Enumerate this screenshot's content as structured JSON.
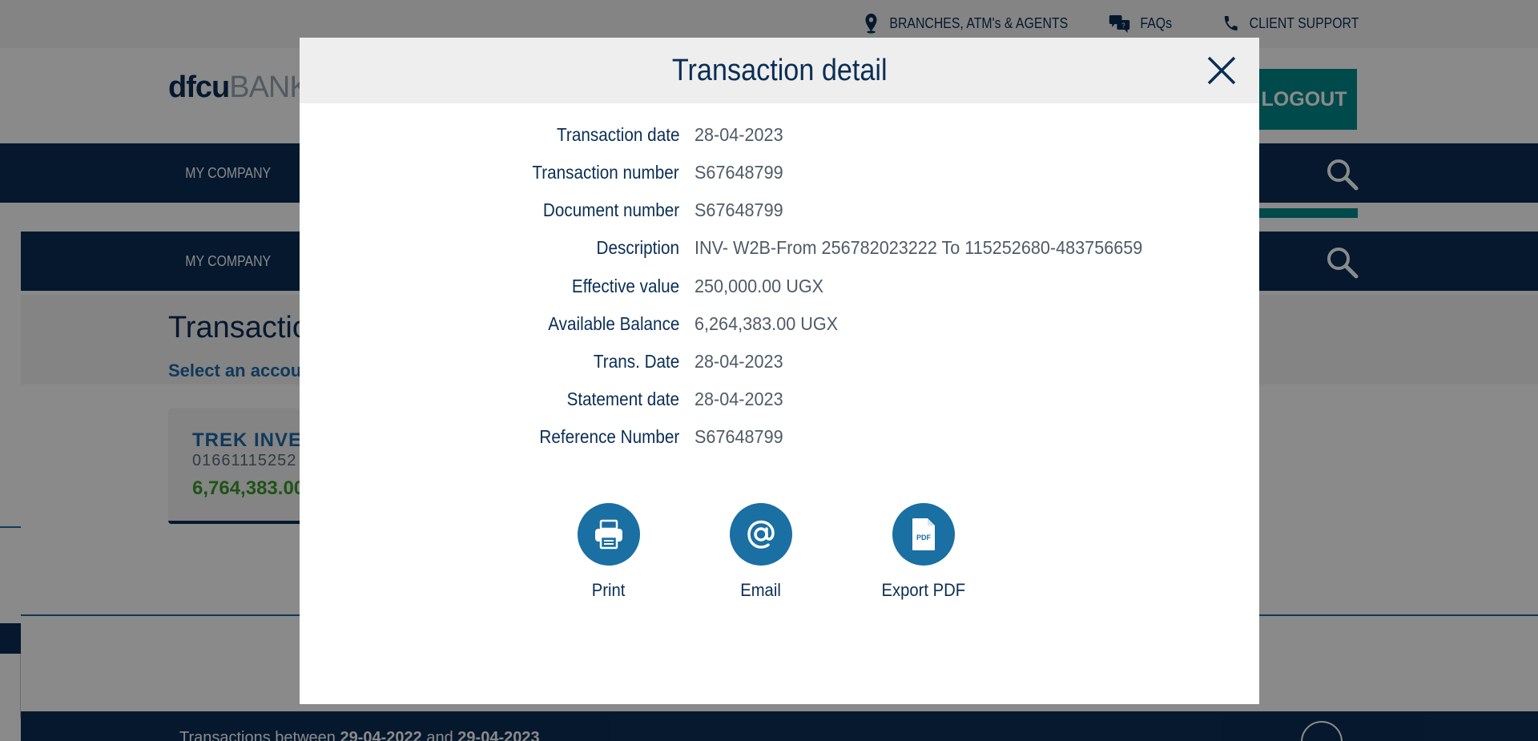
{
  "utility_bar": {
    "branches_label": "BRANCHES, ATM's & AGENTS",
    "faqs_label": "FAQs",
    "support_label": "CLIENT SUPPORT"
  },
  "header": {
    "logo_primary": "dfcu",
    "logo_secondary": "BANK",
    "logout_label": "LOGOUT"
  },
  "navbar": {
    "item_label": "MY COMPANY"
  },
  "page": {
    "title": "Transactions",
    "subtitle": "Select an account"
  },
  "account_card": {
    "name": "TREK INVESTMENTS",
    "number": "01661115252",
    "balance": "6,764,383.00"
  },
  "footer": {
    "prefix": "Transactions between",
    "date_from": "29-04-2022",
    "joiner": "and",
    "date_to": "29-04-2023"
  },
  "modal": {
    "title": "Transaction detail",
    "details": [
      {
        "label": "Transaction date",
        "value": "28-04-2023"
      },
      {
        "label": "Transaction number",
        "value": "S67648799"
      },
      {
        "label": "Document number",
        "value": "S67648799"
      },
      {
        "label": "Description",
        "value": "INV- W2B-From 256782023222 To 115252680-483756659"
      },
      {
        "label": "Effective value",
        "value": "250,000.00 UGX"
      },
      {
        "label": "Available Balance",
        "value": "6,264,383.00 UGX"
      },
      {
        "label": "Trans. Date",
        "value": "28-04-2023"
      },
      {
        "label": "Statement date",
        "value": "28-04-2023"
      },
      {
        "label": "Reference Number",
        "value": "S67648799"
      }
    ],
    "actions": [
      {
        "label": "Print",
        "icon": "printer-icon"
      },
      {
        "label": "Email",
        "icon": "at-sign-icon"
      },
      {
        "label": "Export PDF",
        "icon": "pdf-file-icon"
      }
    ]
  },
  "colors": {
    "navy": "#0b2e55",
    "teal": "#00898c",
    "action_blue": "#1a6fa3",
    "balance_green": "#3a9a2c"
  }
}
